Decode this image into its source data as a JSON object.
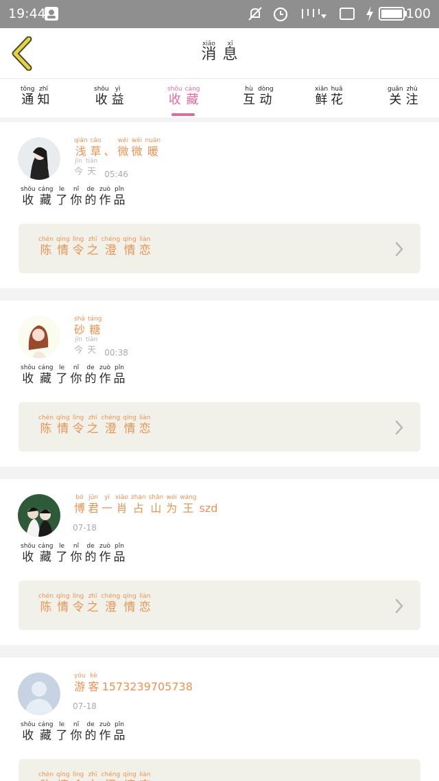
{
  "status_bar": {
    "time": "19:44",
    "battery": "100",
    "icons": [
      "app-notification-icon",
      "mute-icon",
      "alarm-icon",
      "signal-icon",
      "screen-icon",
      "charging-icon",
      "battery-icon"
    ]
  },
  "header": {
    "title": [
      {
        "hz": "消",
        "py": "xiāo"
      },
      {
        "hz": "息",
        "py": "xī"
      }
    ]
  },
  "tabs": [
    {
      "chars": [
        {
          "hz": "通",
          "py": "tōng"
        },
        {
          "hz": "知",
          "py": "zhī"
        }
      ]
    },
    {
      "chars": [
        {
          "hz": "收",
          "py": "shōu"
        },
        {
          "hz": "益",
          "py": "yì"
        }
      ]
    },
    {
      "chars": [
        {
          "hz": "收",
          "py": "shōu"
        },
        {
          "hz": "藏",
          "py": "cáng"
        }
      ],
      "active": true
    },
    {
      "chars": [
        {
          "hz": "互",
          "py": "hù"
        },
        {
          "hz": "动",
          "py": "dòng"
        }
      ]
    },
    {
      "chars": [
        {
          "hz": "鲜",
          "py": "xiān"
        },
        {
          "hz": "花",
          "py": "huā"
        }
      ]
    },
    {
      "chars": [
        {
          "hz": "关",
          "py": "guān"
        },
        {
          "hz": "注",
          "py": "zhù"
        }
      ]
    }
  ],
  "cards": [
    {
      "user": [
        {
          "hz": "浅",
          "py": "qiǎn"
        },
        {
          "hz": "草",
          "py": "cǎo"
        },
        {
          "hz": "、",
          "py": ""
        },
        {
          "hz": "微",
          "py": "wēi"
        },
        {
          "hz": "微",
          "py": "wēi"
        },
        {
          "hz": "暖",
          "py": "nuǎn"
        }
      ],
      "day": [
        {
          "hz": "今",
          "py": "jīn"
        },
        {
          "hz": "天",
          "py": "tiān"
        }
      ],
      "time": "05:46",
      "action": [
        {
          "hz": "收",
          "py": "shōu"
        },
        {
          "hz": "藏",
          "py": "cáng"
        },
        {
          "hz": "了",
          "py": "le"
        },
        {
          "hz": "你",
          "py": "nǐ"
        },
        {
          "hz": "的",
          "py": "de"
        },
        {
          "hz": "作",
          "py": "zuò"
        },
        {
          "hz": "品",
          "py": "pǐn"
        }
      ],
      "work": [
        {
          "hz": "陈",
          "py": "chén"
        },
        {
          "hz": "情",
          "py": "qíng"
        },
        {
          "hz": "令",
          "py": "lìng"
        },
        {
          "hz": "之",
          "py": "zhī"
        },
        {
          "hz": "澄",
          "py": "chéng"
        },
        {
          "hz": "情",
          "py": "qíng"
        },
        {
          "hz": "恋",
          "py": "liàn"
        }
      ],
      "avatar": "portrait-dark"
    },
    {
      "user": [
        {
          "hz": "砂",
          "py": "shā"
        },
        {
          "hz": "糖",
          "py": "táng"
        }
      ],
      "day": [
        {
          "hz": "今",
          "py": "jīn"
        },
        {
          "hz": "天",
          "py": "tiān"
        }
      ],
      "time": "00:38",
      "action": [
        {
          "hz": "收",
          "py": "shōu"
        },
        {
          "hz": "藏",
          "py": "cáng"
        },
        {
          "hz": "了",
          "py": "le"
        },
        {
          "hz": "你",
          "py": "nǐ"
        },
        {
          "hz": "的",
          "py": "de"
        },
        {
          "hz": "作",
          "py": "zuò"
        },
        {
          "hz": "品",
          "py": "pǐn"
        }
      ],
      "work": [
        {
          "hz": "陈",
          "py": "chén"
        },
        {
          "hz": "情",
          "py": "qíng"
        },
        {
          "hz": "令",
          "py": "lìng"
        },
        {
          "hz": "之",
          "py": "zhī"
        },
        {
          "hz": "澄",
          "py": "chéng"
        },
        {
          "hz": "情",
          "py": "qíng"
        },
        {
          "hz": "恋",
          "py": "liàn"
        }
      ],
      "avatar": "portrait-light"
    },
    {
      "user": [
        {
          "hz": "博",
          "py": "bó"
        },
        {
          "hz": "君",
          "py": "jūn"
        },
        {
          "hz": "一",
          "py": "yī"
        },
        {
          "hz": "肖",
          "py": "xiāo"
        },
        {
          "hz": "占",
          "py": "zhàn"
        },
        {
          "hz": "山",
          "py": "shān"
        },
        {
          "hz": "为",
          "py": "wéi"
        },
        {
          "hz": "王",
          "py": "wáng"
        },
        {
          "hz": "szd",
          "py": ""
        }
      ],
      "day": [],
      "time": "07-18",
      "action": [
        {
          "hz": "收",
          "py": "shōu"
        },
        {
          "hz": "藏",
          "py": "cáng"
        },
        {
          "hz": "了",
          "py": "le"
        },
        {
          "hz": "你",
          "py": "nǐ"
        },
        {
          "hz": "的",
          "py": "de"
        },
        {
          "hz": "作",
          "py": "zuò"
        },
        {
          "hz": "品",
          "py": "pǐn"
        }
      ],
      "work": [
        {
          "hz": "陈",
          "py": "chén"
        },
        {
          "hz": "情",
          "py": "qíng"
        },
        {
          "hz": "令",
          "py": "lìng"
        },
        {
          "hz": "之",
          "py": "zhī"
        },
        {
          "hz": "澄",
          "py": "chéng"
        },
        {
          "hz": "情",
          "py": "qíng"
        },
        {
          "hz": "恋",
          "py": "liàn"
        }
      ],
      "avatar": "portrait-couple"
    },
    {
      "user": [
        {
          "hz": "游",
          "py": "yóu"
        },
        {
          "hz": "客",
          "py": "kè"
        },
        {
          "hz": "1573239705738",
          "py": ""
        }
      ],
      "day": [],
      "time": "07-18",
      "action": [
        {
          "hz": "收",
          "py": "shōu"
        },
        {
          "hz": "藏",
          "py": "cáng"
        },
        {
          "hz": "了",
          "py": "le"
        },
        {
          "hz": "你",
          "py": "nǐ"
        },
        {
          "hz": "的",
          "py": "de"
        },
        {
          "hz": "作",
          "py": "zuò"
        },
        {
          "hz": "品",
          "py": "pǐn"
        }
      ],
      "work": [
        {
          "hz": "陈",
          "py": "chén"
        },
        {
          "hz": "情",
          "py": "qíng"
        },
        {
          "hz": "令",
          "py": "lìng"
        },
        {
          "hz": "之",
          "py": "zhī"
        },
        {
          "hz": "澄",
          "py": "chéng"
        },
        {
          "hz": "情",
          "py": "qíng"
        },
        {
          "hz": "恋",
          "py": "liàn"
        }
      ],
      "avatar": "default-user"
    }
  ],
  "colors": {
    "accent_pink": "#e06aa0",
    "username_orange": "#ec9253",
    "work_box_bg": "#f1f1e9",
    "back_arrow": "#e6d24a"
  }
}
